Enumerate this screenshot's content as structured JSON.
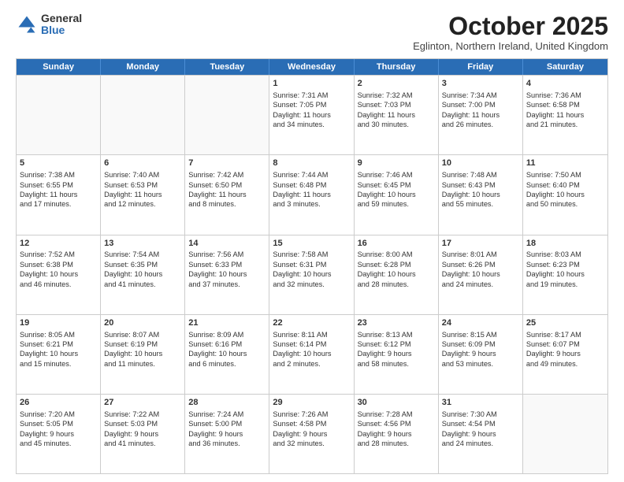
{
  "logo": {
    "general": "General",
    "blue": "Blue"
  },
  "title": "October 2025",
  "location": "Eglinton, Northern Ireland, United Kingdom",
  "weekdays": [
    "Sunday",
    "Monday",
    "Tuesday",
    "Wednesday",
    "Thursday",
    "Friday",
    "Saturday"
  ],
  "rows": [
    [
      {
        "day": "",
        "lines": []
      },
      {
        "day": "",
        "lines": []
      },
      {
        "day": "",
        "lines": []
      },
      {
        "day": "1",
        "lines": [
          "Sunrise: 7:31 AM",
          "Sunset: 7:05 PM",
          "Daylight: 11 hours",
          "and 34 minutes."
        ]
      },
      {
        "day": "2",
        "lines": [
          "Sunrise: 7:32 AM",
          "Sunset: 7:03 PM",
          "Daylight: 11 hours",
          "and 30 minutes."
        ]
      },
      {
        "day": "3",
        "lines": [
          "Sunrise: 7:34 AM",
          "Sunset: 7:00 PM",
          "Daylight: 11 hours",
          "and 26 minutes."
        ]
      },
      {
        "day": "4",
        "lines": [
          "Sunrise: 7:36 AM",
          "Sunset: 6:58 PM",
          "Daylight: 11 hours",
          "and 21 minutes."
        ]
      }
    ],
    [
      {
        "day": "5",
        "lines": [
          "Sunrise: 7:38 AM",
          "Sunset: 6:55 PM",
          "Daylight: 11 hours",
          "and 17 minutes."
        ]
      },
      {
        "day": "6",
        "lines": [
          "Sunrise: 7:40 AM",
          "Sunset: 6:53 PM",
          "Daylight: 11 hours",
          "and 12 minutes."
        ]
      },
      {
        "day": "7",
        "lines": [
          "Sunrise: 7:42 AM",
          "Sunset: 6:50 PM",
          "Daylight: 11 hours",
          "and 8 minutes."
        ]
      },
      {
        "day": "8",
        "lines": [
          "Sunrise: 7:44 AM",
          "Sunset: 6:48 PM",
          "Daylight: 11 hours",
          "and 3 minutes."
        ]
      },
      {
        "day": "9",
        "lines": [
          "Sunrise: 7:46 AM",
          "Sunset: 6:45 PM",
          "Daylight: 10 hours",
          "and 59 minutes."
        ]
      },
      {
        "day": "10",
        "lines": [
          "Sunrise: 7:48 AM",
          "Sunset: 6:43 PM",
          "Daylight: 10 hours",
          "and 55 minutes."
        ]
      },
      {
        "day": "11",
        "lines": [
          "Sunrise: 7:50 AM",
          "Sunset: 6:40 PM",
          "Daylight: 10 hours",
          "and 50 minutes."
        ]
      }
    ],
    [
      {
        "day": "12",
        "lines": [
          "Sunrise: 7:52 AM",
          "Sunset: 6:38 PM",
          "Daylight: 10 hours",
          "and 46 minutes."
        ]
      },
      {
        "day": "13",
        "lines": [
          "Sunrise: 7:54 AM",
          "Sunset: 6:35 PM",
          "Daylight: 10 hours",
          "and 41 minutes."
        ]
      },
      {
        "day": "14",
        "lines": [
          "Sunrise: 7:56 AM",
          "Sunset: 6:33 PM",
          "Daylight: 10 hours",
          "and 37 minutes."
        ]
      },
      {
        "day": "15",
        "lines": [
          "Sunrise: 7:58 AM",
          "Sunset: 6:31 PM",
          "Daylight: 10 hours",
          "and 32 minutes."
        ]
      },
      {
        "day": "16",
        "lines": [
          "Sunrise: 8:00 AM",
          "Sunset: 6:28 PM",
          "Daylight: 10 hours",
          "and 28 minutes."
        ]
      },
      {
        "day": "17",
        "lines": [
          "Sunrise: 8:01 AM",
          "Sunset: 6:26 PM",
          "Daylight: 10 hours",
          "and 24 minutes."
        ]
      },
      {
        "day": "18",
        "lines": [
          "Sunrise: 8:03 AM",
          "Sunset: 6:23 PM",
          "Daylight: 10 hours",
          "and 19 minutes."
        ]
      }
    ],
    [
      {
        "day": "19",
        "lines": [
          "Sunrise: 8:05 AM",
          "Sunset: 6:21 PM",
          "Daylight: 10 hours",
          "and 15 minutes."
        ]
      },
      {
        "day": "20",
        "lines": [
          "Sunrise: 8:07 AM",
          "Sunset: 6:19 PM",
          "Daylight: 10 hours",
          "and 11 minutes."
        ]
      },
      {
        "day": "21",
        "lines": [
          "Sunrise: 8:09 AM",
          "Sunset: 6:16 PM",
          "Daylight: 10 hours",
          "and 6 minutes."
        ]
      },
      {
        "day": "22",
        "lines": [
          "Sunrise: 8:11 AM",
          "Sunset: 6:14 PM",
          "Daylight: 10 hours",
          "and 2 minutes."
        ]
      },
      {
        "day": "23",
        "lines": [
          "Sunrise: 8:13 AM",
          "Sunset: 6:12 PM",
          "Daylight: 9 hours",
          "and 58 minutes."
        ]
      },
      {
        "day": "24",
        "lines": [
          "Sunrise: 8:15 AM",
          "Sunset: 6:09 PM",
          "Daylight: 9 hours",
          "and 53 minutes."
        ]
      },
      {
        "day": "25",
        "lines": [
          "Sunrise: 8:17 AM",
          "Sunset: 6:07 PM",
          "Daylight: 9 hours",
          "and 49 minutes."
        ]
      }
    ],
    [
      {
        "day": "26",
        "lines": [
          "Sunrise: 7:20 AM",
          "Sunset: 5:05 PM",
          "Daylight: 9 hours",
          "and 45 minutes."
        ]
      },
      {
        "day": "27",
        "lines": [
          "Sunrise: 7:22 AM",
          "Sunset: 5:03 PM",
          "Daylight: 9 hours",
          "and 41 minutes."
        ]
      },
      {
        "day": "28",
        "lines": [
          "Sunrise: 7:24 AM",
          "Sunset: 5:00 PM",
          "Daylight: 9 hours",
          "and 36 minutes."
        ]
      },
      {
        "day": "29",
        "lines": [
          "Sunrise: 7:26 AM",
          "Sunset: 4:58 PM",
          "Daylight: 9 hours",
          "and 32 minutes."
        ]
      },
      {
        "day": "30",
        "lines": [
          "Sunrise: 7:28 AM",
          "Sunset: 4:56 PM",
          "Daylight: 9 hours",
          "and 28 minutes."
        ]
      },
      {
        "day": "31",
        "lines": [
          "Sunrise: 7:30 AM",
          "Sunset: 4:54 PM",
          "Daylight: 9 hours",
          "and 24 minutes."
        ]
      },
      {
        "day": "",
        "lines": []
      }
    ]
  ]
}
